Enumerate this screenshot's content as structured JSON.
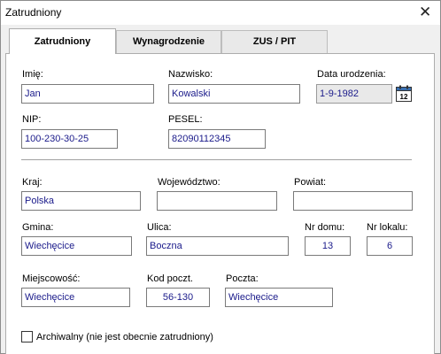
{
  "window": {
    "title": "Zatrudniony",
    "close_glyph": "✕"
  },
  "tabs": [
    {
      "label": "Zatrudniony",
      "active": true
    },
    {
      "label": "Wynagrodzenie",
      "active": false
    },
    {
      "label": "ZUS / PIT",
      "active": false
    }
  ],
  "form": {
    "imie": {
      "label": "Imię:",
      "value": "Jan"
    },
    "nazwisko": {
      "label": "Nazwisko:",
      "value": "Kowalski"
    },
    "data_urodzenia": {
      "label": "Data urodzenia:",
      "value": "1-9-1982",
      "calendar_icon": "calendar-icon",
      "calendar_day": "12"
    },
    "nip": {
      "label": "NIP:",
      "value": "100-230-30-25"
    },
    "pesel": {
      "label": "PESEL:",
      "value": "82090112345"
    },
    "kraj": {
      "label": "Kraj:",
      "value": "Polska"
    },
    "wojewodztwo": {
      "label": "Województwo:",
      "value": ""
    },
    "powiat": {
      "label": "Powiat:",
      "value": ""
    },
    "gmina": {
      "label": "Gmina:",
      "value": "Wiechęcice"
    },
    "ulica": {
      "label": "Ulica:",
      "value": "Boczna"
    },
    "nr_domu": {
      "label": "Nr domu:",
      "value": "13"
    },
    "nr_lokalu": {
      "label": "Nr lokalu:",
      "value": "6"
    },
    "miejscowosc": {
      "label": "Miejscowość:",
      "value": "Wiechęcice"
    },
    "kod_poczt": {
      "label": "Kod poczt.",
      "value": "56-130"
    },
    "poczta": {
      "label": "Poczta:",
      "value": "Wiechęcice"
    },
    "archiwalny": {
      "label": "Archiwalny (nie jest obecnie zatrudniony)",
      "checked": false
    }
  },
  "colors": {
    "field_text": "#1a1a8a",
    "accent": "#1a1a8a"
  }
}
